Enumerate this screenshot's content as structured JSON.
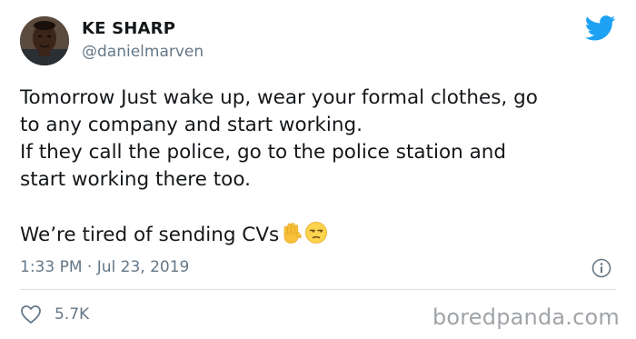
{
  "user": {
    "display_name": "KE SHARP",
    "handle": "@danielmarven"
  },
  "tweet": {
    "lines": [
      "Tomorrow Just wake up, wear your formal clothes, go",
      "to any company and start working.",
      "If they call the police, go to the police station and",
      "start working there too."
    ],
    "last_line": "We’re tired of sending CVs",
    "emojis": [
      "raised-hand-emoji",
      "unamused-face-emoji"
    ],
    "timestamp": "1:33 PM · Jul 23, 2019",
    "likes": "5.7K"
  },
  "watermark": "boredpanda.com",
  "colors": {
    "twitter_blue": "#1da1f2",
    "secondary_text": "#657786",
    "primary_text": "#14171a",
    "divider": "#d8dee3"
  },
  "icons": {
    "logo": "twitter-bird-icon",
    "info": "info-icon",
    "like": "heart-icon"
  }
}
